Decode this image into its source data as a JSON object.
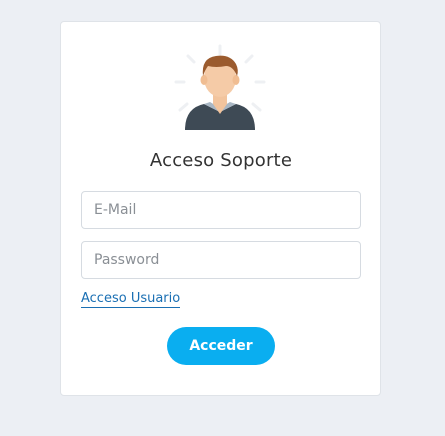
{
  "login": {
    "title": "Acceso Soporte",
    "email_placeholder": "E-Mail",
    "password_placeholder": "Password",
    "user_access_link": "Acceso Usuario",
    "submit_label": "Acceder"
  },
  "icons": {
    "avatar": "user-avatar-icon"
  },
  "colors": {
    "background": "#eceff4",
    "card": "#ffffff",
    "accent": "#0aaef0",
    "link": "#1a6fb3"
  }
}
